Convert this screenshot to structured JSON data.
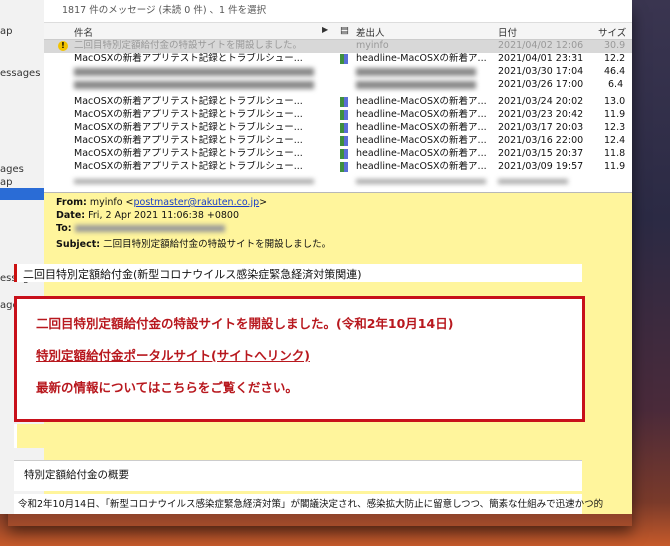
{
  "status_text": "1817 件のメッセージ (未読 0 件) 、1 件を選択",
  "sidebar": {
    "items": [
      "ap",
      "essages",
      "ages",
      "ap",
      "essages",
      "ages"
    ]
  },
  "list_header": {
    "subject": "件名",
    "from": "差出人",
    "date": "日付",
    "size": "サイズ"
  },
  "messages": [
    {
      "subject": "二回目特別定額給付金の特設サイトを開設しました。",
      "from": "myinfo",
      "date": "2021/04/02  12:06",
      "size": "30.9"
    },
    {
      "subject": "MacOSXの新着アプリテスト記録とトラブルシュー...",
      "from": "headline-MacOSXの新着ア...",
      "date": "2021/04/01  23:31",
      "size": "12.2"
    },
    {
      "subject": "",
      "from": "",
      "date": "2021/03/30  17:04",
      "size": "46.4"
    },
    {
      "subject": "",
      "from": "",
      "date": "2021/03/26  17:00",
      "size": "6.4"
    },
    {
      "subject": "MacOSXの新着アプリテスト記録とトラブルシュー...",
      "from": "headline-MacOSXの新着ア...",
      "date": "2021/03/24  20:02",
      "size": "13.0"
    },
    {
      "subject": "MacOSXの新着アプリテスト記録とトラブルシュー...",
      "from": "headline-MacOSXの新着ア...",
      "date": "2021/03/23  20:42",
      "size": "11.9"
    },
    {
      "subject": "MacOSXの新着アプリテスト記録とトラブルシュー...",
      "from": "headline-MacOSXの新着ア...",
      "date": "2021/03/17  20:03",
      "size": "12.3"
    },
    {
      "subject": "MacOSXの新着アプリテスト記録とトラブルシュー...",
      "from": "headline-MacOSXの新着ア...",
      "date": "2021/03/16  22:00",
      "size": "12.4"
    },
    {
      "subject": "MacOSXの新着アプリテスト記録とトラブルシュー...",
      "from": "headline-MacOSXの新着ア...",
      "date": "2021/03/15  20:37",
      "size": "11.8"
    },
    {
      "subject": "MacOSXの新着アプリテスト記録とトラブルシュー...",
      "from": "headline-MacOSXの新着ア...",
      "date": "2021/03/09  19:57",
      "size": "11.9"
    }
  ],
  "preview": {
    "from_label": "From:",
    "from_name": "myinfo",
    "from_email": "postmaster@rakuten.co.jp",
    "date_label": "Date:",
    "date_value": "Fri, 2 Apr 2021 11:06:38 +0800",
    "to_label": "To:",
    "subject_label": "Subject:",
    "subject_value": "二回目特別定額給付金の特設サイトを開設しました。",
    "banner_title": "二回目特別定額給付金(新型コロナウイルス感染症緊急経済対策関連)",
    "red_line1": "二回目特別定額給付金の特設サイトを開設しました。(令和2年10月14日)",
    "red_link": "特別定額給付金ポータルサイト(サイトへリンク)",
    "red_line3": "最新の情報についてはこちらをご覧ください。",
    "overview_title": "特別定額給付金の概要",
    "body_line": "令和2年10月14日、「新型コロナウイルス感染症緊急経済対策」が閣議決定され、感染拡大防止に留意しつつ、簡素な仕組みで迅速かつ的"
  },
  "colors": {
    "alert_red": "#c8101a",
    "preview_yellow": "#fff59c",
    "selection_blue": "#2a6cd6"
  }
}
